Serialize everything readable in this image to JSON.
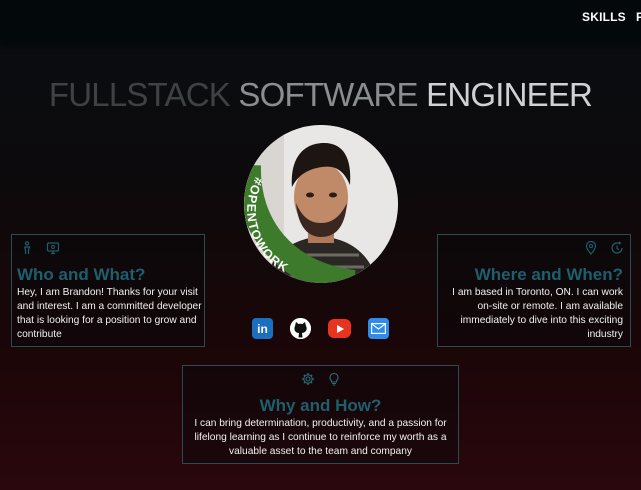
{
  "nav": {
    "skills_label": "SKILLS",
    "next_label": "P"
  },
  "headline": {
    "part1": "FULLSTACK",
    "part2": "SOFTWARE",
    "part3": "ENGINEER"
  },
  "avatar": {
    "badge_text": "#OPENTOWORK"
  },
  "who": {
    "title": "Who and What?",
    "body": "Hey, I am Brandon! Thanks for your visit and interest. I am a committed developer that is looking for a position to grow and contribute",
    "icons": [
      "person-icon",
      "monitor-icon"
    ]
  },
  "where": {
    "title": "Where and When?",
    "body": "I am based in Toronto, ON. I can work on-site or remote. I am available immediately to dive into this exciting industry",
    "icons": [
      "location-pin-icon",
      "clock-refresh-icon"
    ]
  },
  "why": {
    "title": "Why and How?",
    "body": "I can bring determination, productivity, and a passion for lifelong learning as I continue to reinforce my worth as a valuable asset to the team and company",
    "icons": [
      "gear-icon",
      "lightbulb-icon"
    ]
  },
  "socials": [
    {
      "name": "linkedin-icon",
      "label": "in"
    },
    {
      "name": "github-icon"
    },
    {
      "name": "youtube-icon"
    },
    {
      "name": "mail-icon"
    }
  ],
  "colors": {
    "accent": "#1d5f6c",
    "border": "#2c4a50",
    "badge": "#3e7a2c"
  }
}
